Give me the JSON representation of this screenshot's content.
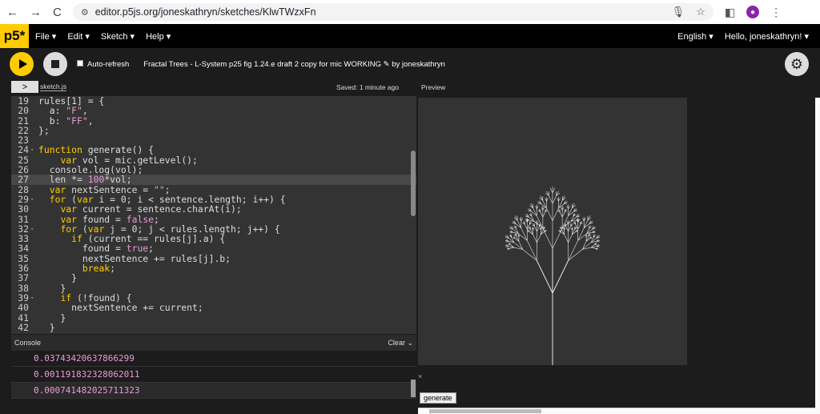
{
  "browser": {
    "url": "editor.p5js.org/joneskathryn/sketches/KlwTWzxFn",
    "back": "←",
    "forward": "→",
    "reload": "C"
  },
  "menubar": {
    "logo": "p5*",
    "items": [
      "File ▾",
      "Edit ▾",
      "Sketch ▾",
      "Help ▾"
    ],
    "language": "English ▾",
    "user": "Hello, joneskathryn! ▾"
  },
  "toolbar": {
    "auto_refresh": "Auto-refresh",
    "sketch_title": "Fractal Trees - L-System p25 fig 1.24.e draft 2 copy for mic WORKING ✎ by joneskathryn"
  },
  "tabs": {
    "toggle": ">",
    "file": "sketch.js",
    "saved": "Saved: 1 minute ago",
    "preview": "Preview"
  },
  "code": [
    {
      "n": "19",
      "t": "rules[1] = {"
    },
    {
      "n": "20",
      "t": "  a: \"F\","
    },
    {
      "n": "21",
      "t": "  b: \"FF\","
    },
    {
      "n": "22",
      "t": "};"
    },
    {
      "n": "23",
      "t": ""
    },
    {
      "n": "24",
      "t": "function generate() {",
      "fold": true
    },
    {
      "n": "25",
      "t": "    var vol = mic.getLevel();"
    },
    {
      "n": "26",
      "t": "  console.log(vol);"
    },
    {
      "n": "27",
      "t": "  len *= 100*vol;",
      "hl": true
    },
    {
      "n": "28",
      "t": "  var nextSentence = \"\";"
    },
    {
      "n": "29",
      "t": "  for (var i = 0; i < sentence.length; i++) {",
      "fold": true
    },
    {
      "n": "30",
      "t": "    var current = sentence.charAt(i);"
    },
    {
      "n": "31",
      "t": "    var found = false;"
    },
    {
      "n": "32",
      "t": "    for (var j = 0; j < rules.length; j++) {",
      "fold": true
    },
    {
      "n": "33",
      "t": "      if (current == rules[j].a) {"
    },
    {
      "n": "34",
      "t": "        found = true;"
    },
    {
      "n": "35",
      "t": "        nextSentence += rules[j].b;"
    },
    {
      "n": "36",
      "t": "        break;"
    },
    {
      "n": "37",
      "t": "      }"
    },
    {
      "n": "38",
      "t": "    }"
    },
    {
      "n": "39",
      "t": "    if (!found) {",
      "fold": true
    },
    {
      "n": "40",
      "t": "      nextSentence += current;"
    },
    {
      "n": "41",
      "t": "    }"
    },
    {
      "n": "42",
      "t": "  }"
    }
  ],
  "console": {
    "title": "Console",
    "clear": "Clear",
    "lines": [
      "0.037434206378662​99",
      "0.001191832328062011",
      "0.0007414820257113​23"
    ]
  },
  "preview": {
    "close": "×",
    "generate": "generate"
  },
  "colors": {
    "p5_yellow": "#ffcc00",
    "editor_bg": "#333333",
    "string_pink": "#ed9bd3"
  }
}
